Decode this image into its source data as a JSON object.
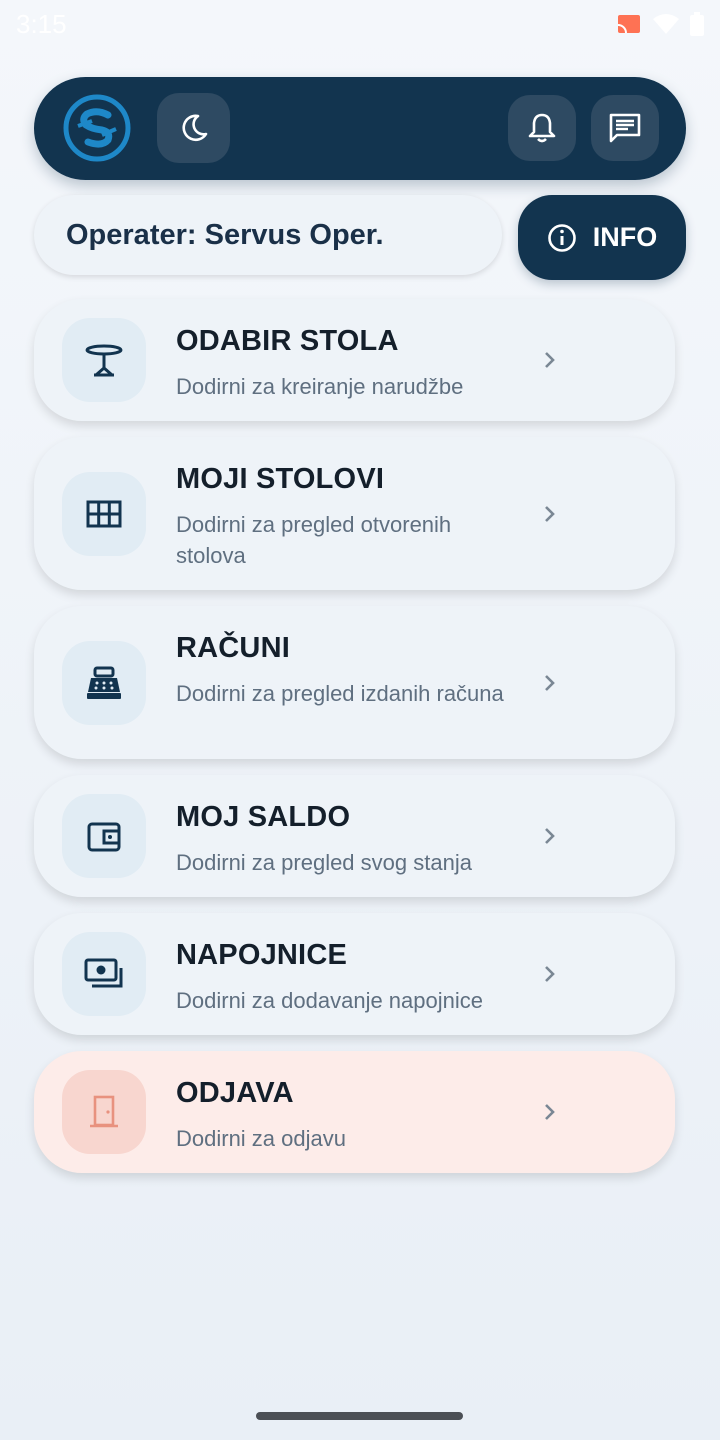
{
  "status": {
    "time": "3:15"
  },
  "operator": {
    "text": "Operater: Servus Oper."
  },
  "info": {
    "label": "INFO"
  },
  "menu": [
    {
      "title": "ODABIR STOLA",
      "subtitle": "Dodirni za kreiranje narudžbe",
      "icon": "table-icon"
    },
    {
      "title": "MOJI STOLOVI",
      "subtitle": "Dodirni za pregled otvorenih stolova",
      "icon": "grid-icon"
    },
    {
      "title": "RAČUNI",
      "subtitle": "Dodirni za pregled izdanih računa",
      "icon": "cash-register-icon"
    },
    {
      "title": "MOJ SALDO",
      "subtitle": "Dodirni za pregled svog stanja",
      "icon": "wallet-icon"
    },
    {
      "title": "NAPOJNICE",
      "subtitle": "Dodirni za dodavanje napojnice",
      "icon": "money-icon"
    },
    {
      "title": "ODJAVA",
      "subtitle": "Dodirni za odjavu",
      "icon": "door-icon"
    }
  ],
  "colors": {
    "primary": "#12344f",
    "logout_bg": "#fdece9",
    "logout_icon": "#e8927f"
  }
}
